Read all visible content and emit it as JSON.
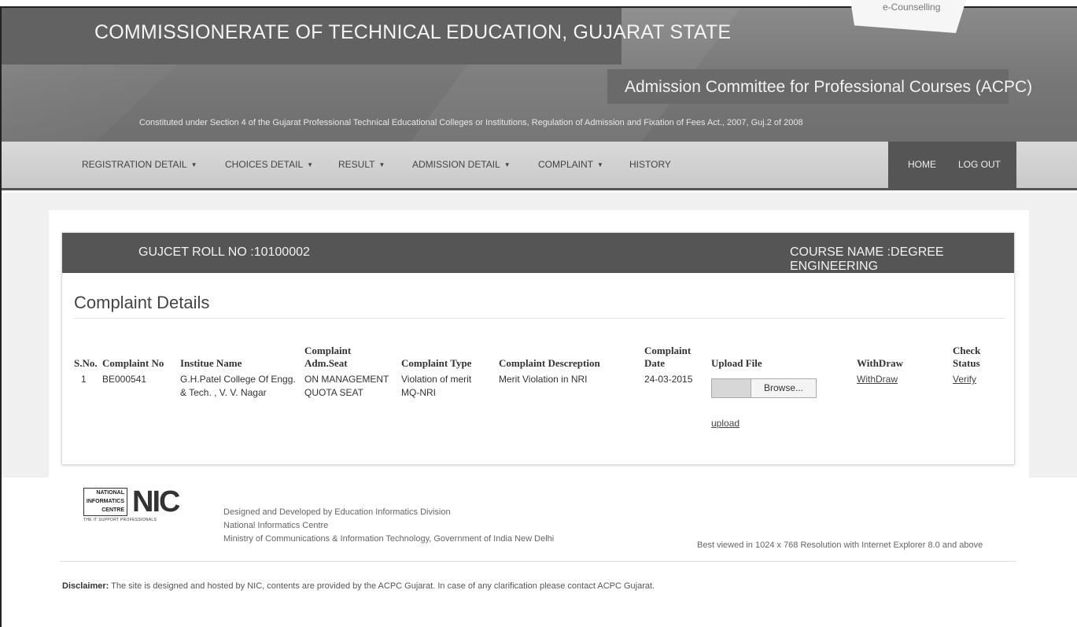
{
  "header": {
    "title": "COMMISSIONERATE OF TECHNICAL EDUCATION, GUJARAT STATE",
    "subtitle": "Admission Committee for Professional Courses (ACPC)",
    "constituted": "Constituted under Section 4 of the Gujarat Professional Technical Educational Colleges or Institutions, Regulation of Admission and Fixation of Fees Act., 2007, Guj.2 of 2008",
    "badge": "e-Counselling"
  },
  "nav": {
    "items": [
      {
        "label": "REGISTRATION DETAIL",
        "caret": "▼"
      },
      {
        "label": "CHOICES DETAIL",
        "caret": "▼"
      },
      {
        "label": "RESULT",
        "caret": "▼"
      },
      {
        "label": "ADMISSION DETAIL",
        "caret": "▼"
      },
      {
        "label": "COMPLAINT",
        "caret": "▼"
      },
      {
        "label": "HISTORY",
        "caret": ""
      }
    ],
    "right": {
      "home": "HOME",
      "logout": "LOG OUT"
    }
  },
  "panel": {
    "roll": "GUJCET ROLL NO :10100002",
    "course": "COURSE NAME :DEGREE ENGINEERING",
    "section_title": "Complaint Details"
  },
  "table": {
    "headers": {
      "sno": "S.No.",
      "complaint_no": "Complaint No",
      "institute": "Institue Name",
      "adm_seat_1": "Complaint",
      "adm_seat_2": "Adm.Seat",
      "type": "Complaint Type",
      "descreption": "Complaint Descreption",
      "date_1": "Complaint",
      "date_2": "Date",
      "upload": "Upload File",
      "withdraw": "WithDraw",
      "status_1": "Check",
      "status_2": "Status"
    },
    "row": {
      "sno": "1",
      "complaint_no": "BE000541",
      "institute_1": "G.H.Patel College Of Engg.",
      "institute_2": "& Tech. , V. V. Nagar",
      "adm_seat_1": "ON MANAGEMENT",
      "adm_seat_2": "QUOTA SEAT",
      "type_1": "Violation of merit",
      "type_2": "MQ-NRI",
      "descreption": "Merit Violation in NRI",
      "date": "24-03-2015",
      "browse": "Browse...",
      "upload_link": "upload",
      "withdraw_link": "WithDraw",
      "verify_link": "Verify"
    }
  },
  "footer": {
    "logo_text": "NATIONAL INFORMATICS CENTRE",
    "logo_big": "NIC",
    "logo_tag": "THE IT SUPPORT PROFESSIONALS",
    "designed_1": "Designed and Developed by Education Informatics Division",
    "designed_2": "National Informatics Centre",
    "designed_3": "Ministry of Communications & Information Technology, Government of India New Delhi",
    "best_viewed": "Best viewed in 1024 x 768 Resolution with Internet Explorer 8.0 and above",
    "disclaimer_label": "Disclaimer:",
    "disclaimer_text": " The site is designed and hosted by NIC, contents are provided by the ACPC Gujarat. In case of any clarification please contact ACPC Gujarat."
  }
}
